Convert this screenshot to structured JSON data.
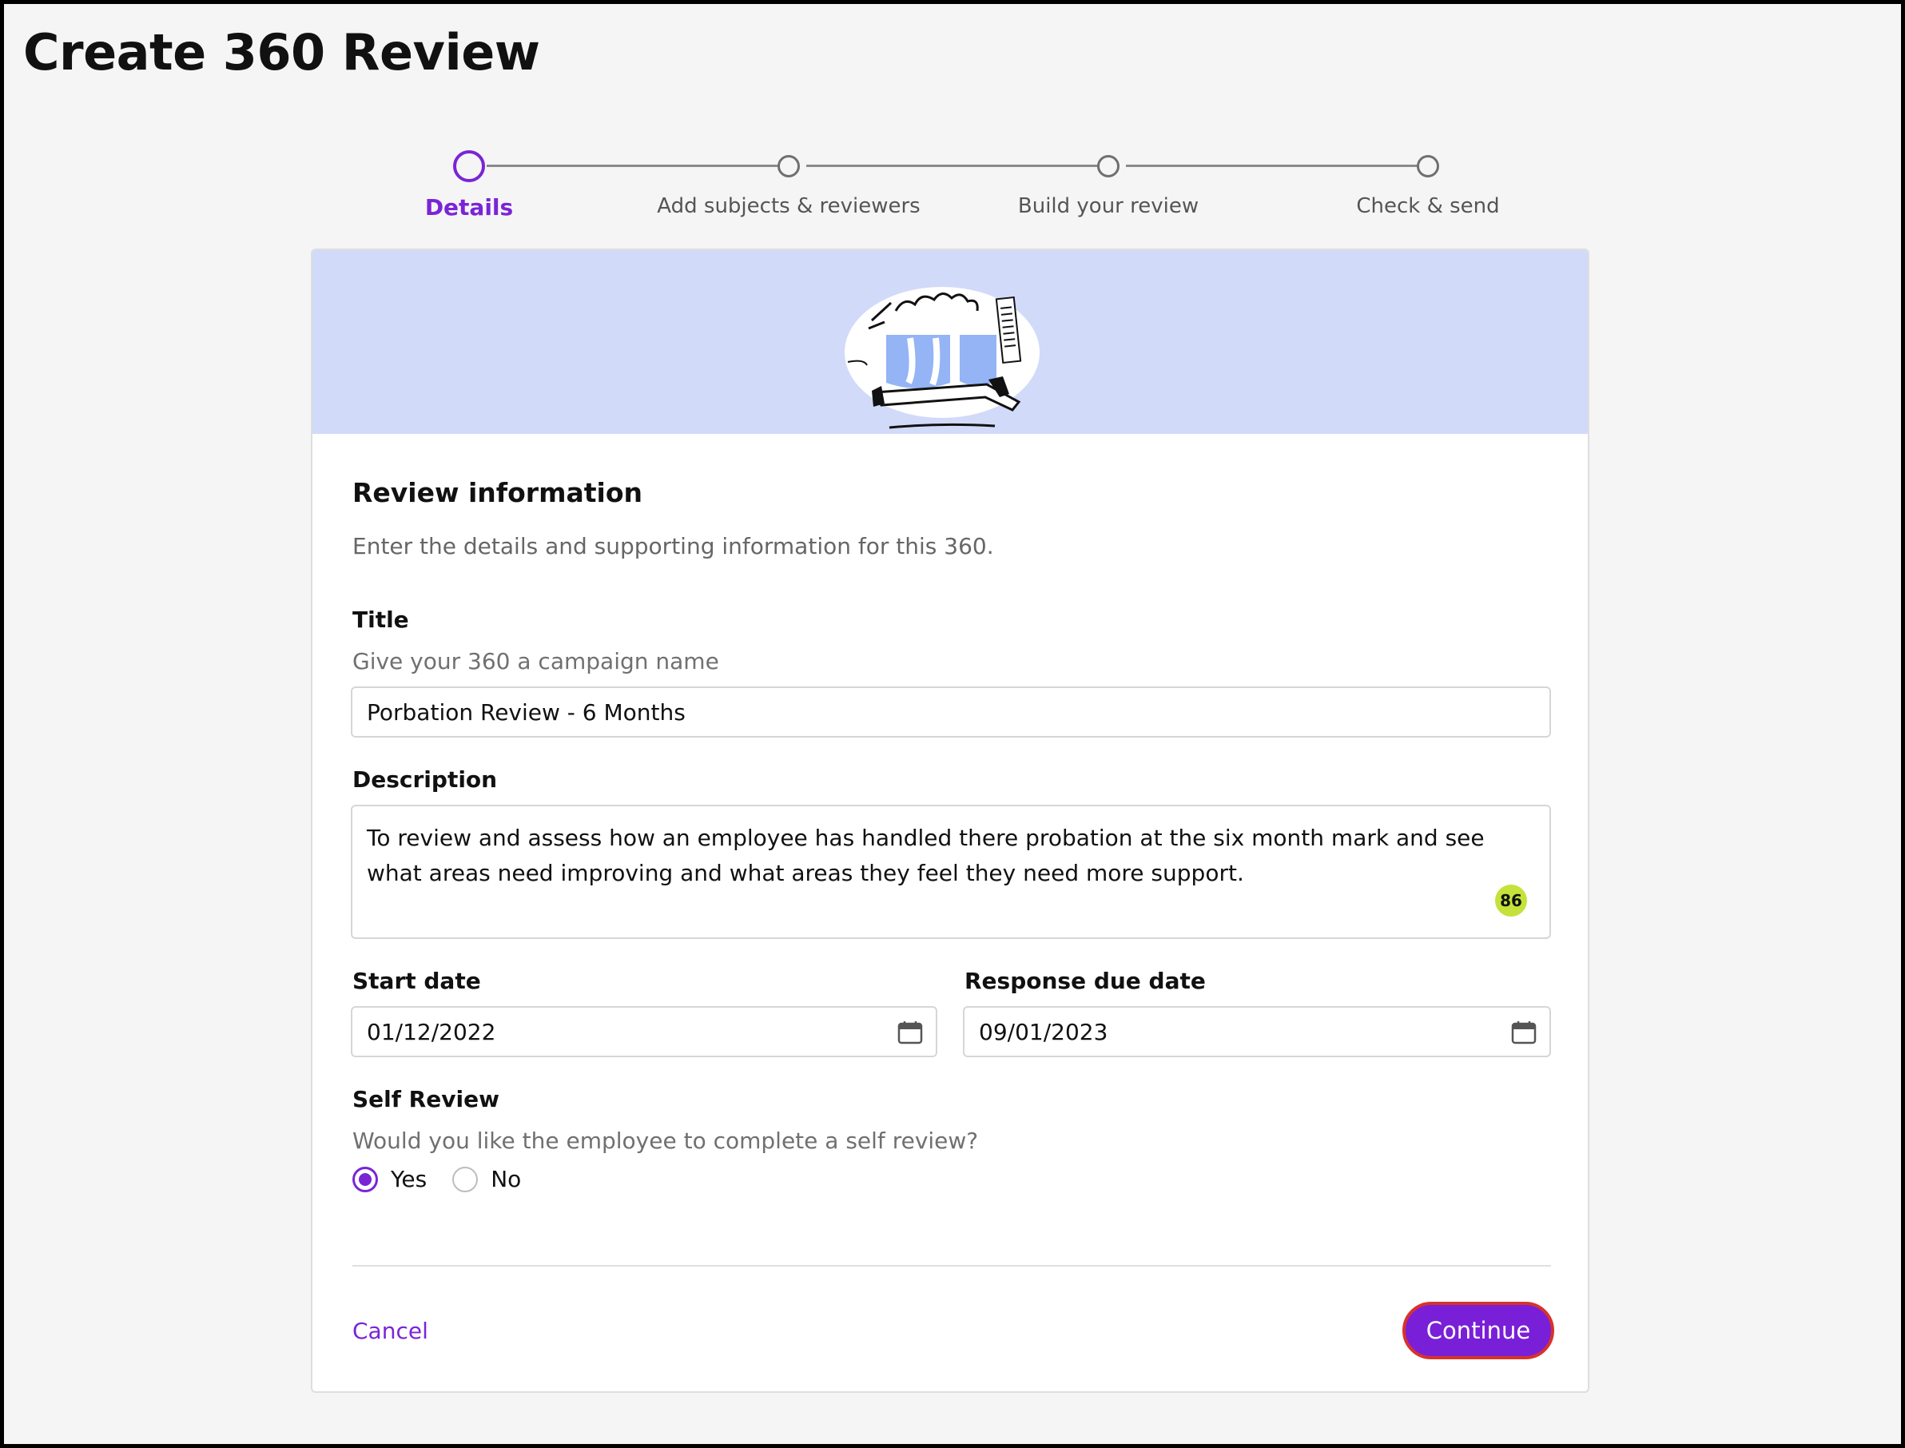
{
  "page": {
    "title": "Create 360 Review"
  },
  "stepper": {
    "steps": [
      {
        "label": "Details",
        "active": true
      },
      {
        "label": "Add subjects & reviewers",
        "active": false
      },
      {
        "label": "Build your review",
        "active": false
      },
      {
        "label": "Check & send",
        "active": false
      }
    ]
  },
  "form": {
    "section_title": "Review information",
    "section_subtitle": "Enter the details and supporting information for this 360.",
    "title_field": {
      "label": "Title",
      "hint": "Give your 360 a campaign name",
      "value": "Porbation Review - 6 Months"
    },
    "description_field": {
      "label": "Description",
      "value": "To review and assess how an employee has handled there probation at the six month mark and see what areas need improving and what areas they feel they need more support.",
      "char_counter": "86"
    },
    "start_date": {
      "label": "Start date",
      "value": "01/12/2022"
    },
    "due_date": {
      "label": "Response due date",
      "value": "09/01/2023"
    },
    "self_review": {
      "label": "Self Review",
      "hint": "Would you like the employee to complete a self review?",
      "options": [
        {
          "label": "Yes",
          "checked": true
        },
        {
          "label": "No",
          "checked": false
        }
      ]
    }
  },
  "footer": {
    "cancel_label": "Cancel",
    "continue_label": "Continue"
  },
  "colors": {
    "accent": "#7a24d6",
    "banner": "#d2daf9",
    "counter_badge": "#c4e23a",
    "focus_ring": "#d6332c"
  }
}
